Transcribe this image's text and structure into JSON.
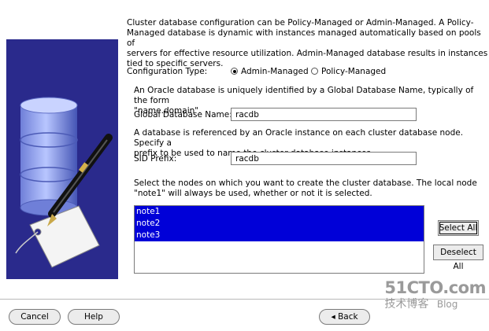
{
  "description": {
    "line1": "Cluster database configuration can be Policy-Managed or Admin-Managed. A Policy-",
    "line2": "Managed database is dynamic with instances managed automatically based on pools of",
    "line3": "servers for effective resource utilization. Admin-Managed database results in instances",
    "line4": "tied to specific servers."
  },
  "config_type": {
    "label": "Configuration Type:",
    "options": [
      "Admin-Managed",
      "Policy-Managed"
    ],
    "selected": "Admin-Managed"
  },
  "global_db": {
    "desc_line1": "An Oracle database is uniquely identified by a Global Database Name, typically of the form",
    "desc_line2": "\"name.domain\".",
    "label": "Global Database Name:",
    "value": "racdb"
  },
  "sid": {
    "desc_line1": "A database is referenced by an Oracle instance on each cluster database node. Specify a",
    "desc_line2": "prefix to be used to name the cluster database instances.",
    "label": "SID Prefix:",
    "value": "racdb"
  },
  "nodes": {
    "desc_line1": "Select the nodes on which you want to create the cluster database. The local node",
    "desc_line2": "\"note1\" will always be used, whether or not it is selected.",
    "items": [
      "note1",
      "note2",
      "note3"
    ]
  },
  "buttons": {
    "select_all": "Select All",
    "deselect_all": "Deselect All",
    "cancel": "Cancel",
    "help": "Help",
    "back": "Back"
  },
  "watermark": {
    "site": "51CTO.com",
    "sub": "技术博客",
    "blog": "Blog"
  },
  "colors": {
    "selection": "#0000d8",
    "art_background": "#2a2a8c"
  }
}
